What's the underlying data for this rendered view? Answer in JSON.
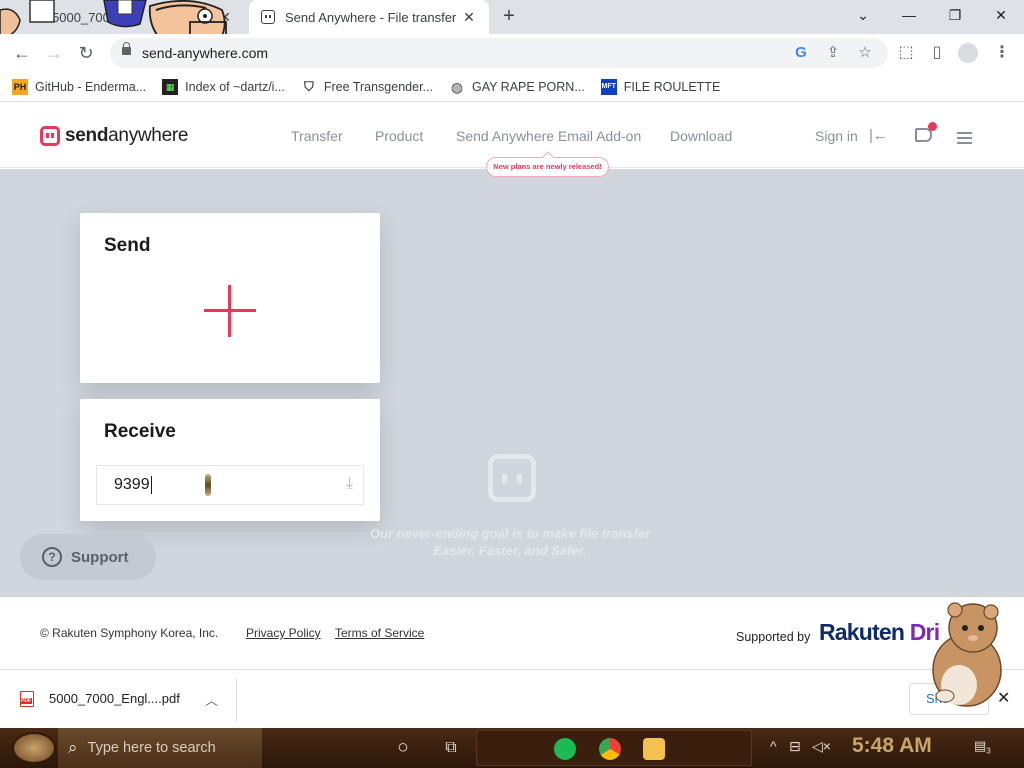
{
  "browser": {
    "tabs": [
      {
        "title": "5000_7000_",
        "active": false
      },
      {
        "title": "Send Anywhere - File transfer",
        "active": true
      }
    ],
    "new_tab": "+",
    "url": "send-anywhere.com",
    "window_controls": {
      "search_tabs": "⌄",
      "minimize": "—",
      "restore": "❐",
      "close": "✕"
    }
  },
  "bookmarks": [
    {
      "icon": "PH",
      "label": "GitHub - Enderma..."
    },
    {
      "icon": "dartz",
      "label": "Index of ~dartz/i..."
    },
    {
      "icon": "shield",
      "label": "Free Transgender..."
    },
    {
      "icon": "globe",
      "label": "GAY RAPE PORN..."
    },
    {
      "icon": "MFT",
      "label": "FILE ROULETTE"
    }
  ],
  "site": {
    "logo": {
      "bold": "send",
      "rest": "anywhere"
    },
    "nav": [
      "Transfer",
      "Product",
      "Send Anywhere Email Add-on",
      "Download"
    ],
    "badge": "New plans are newly released!",
    "signin": "Sign in",
    "send_card": {
      "title": "Send"
    },
    "receive_card": {
      "title": "Receive",
      "key_value": "9399"
    },
    "tagline": "Our never-ending goal is to make file transfer Easier, Faster, and Safer.",
    "support": "Support",
    "footer": {
      "copyright": "© Rakuten Symphony Korea, Inc.",
      "privacy": "Privacy Policy",
      "terms": "Terms of Service",
      "supported": "Supported by",
      "sponsor_a": "Rakuten ",
      "sponsor_b": "Dri"
    }
  },
  "downloads": {
    "file": "5000_7000_Engl....pdf",
    "show_all": "Sho"
  },
  "taskbar": {
    "search_placeholder": "Type here to search",
    "clock": "5:48 AM",
    "notifications": "3"
  },
  "colors": {
    "accent": "#e6395c",
    "main_bg": "#d0d6dc",
    "brand_dark": "#0e2a6b"
  }
}
